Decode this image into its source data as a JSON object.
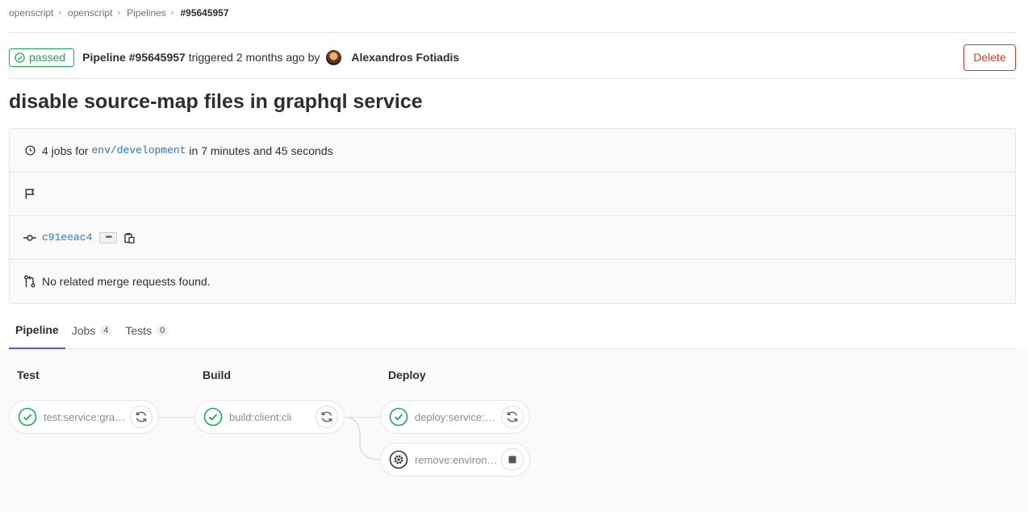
{
  "breadcrumb": {
    "items": [
      "openscript",
      "openscript",
      "Pipelines"
    ],
    "current": "#95645957"
  },
  "header": {
    "status": "passed",
    "pipeline_label": "Pipeline #95645957",
    "triggered_text": " triggered 2 months ago by",
    "author": "Alexandros Fotiadis",
    "delete_label": "Delete"
  },
  "title": "disable source-map files in graphql service",
  "info": {
    "jobs_prefix": "4 jobs for ",
    "branch": "env/development",
    "jobs_suffix": " in 7 minutes and 45 seconds",
    "commit_sha": "c91eeac4",
    "ellipsis": "•••",
    "merge_requests": "No related merge requests found."
  },
  "tabs": [
    {
      "label": "Pipeline",
      "count": null
    },
    {
      "label": "Jobs",
      "count": "4"
    },
    {
      "label": "Tests",
      "count": "0"
    }
  ],
  "stages": [
    {
      "name": "Test"
    },
    {
      "name": "Build"
    },
    {
      "name": "Deploy"
    }
  ],
  "jobs": [
    {
      "label": "test:service:graphql",
      "status": "success",
      "action": "retry"
    },
    {
      "label": "build:client:cli",
      "status": "success",
      "action": "retry"
    },
    {
      "label": "deploy:service:graphql",
      "status": "success",
      "action": "retry"
    },
    {
      "label": "remove:environment",
      "status": "manual",
      "action": "stop"
    }
  ],
  "colors": {
    "success": "#1aaa55",
    "danger": "#db3b21",
    "link": "#1f78d1",
    "tab_active": "#6b4fbb"
  }
}
